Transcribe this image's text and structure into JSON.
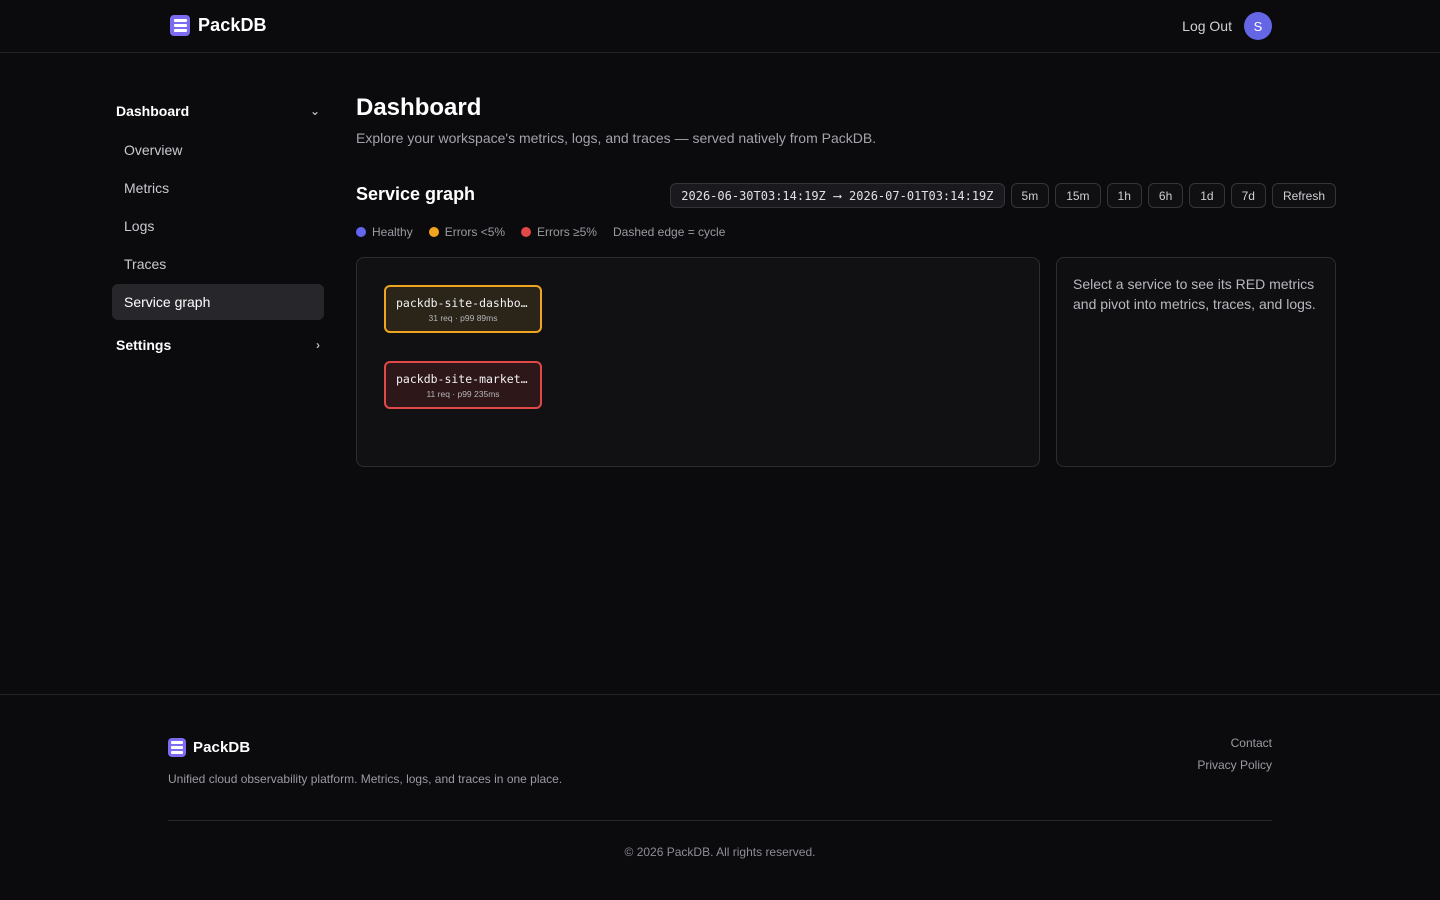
{
  "header": {
    "brand": "PackDB",
    "logout_label": "Log Out",
    "avatar_initial": "S"
  },
  "sidebar": {
    "sections": [
      {
        "label": "Dashboard",
        "expanded": true
      },
      {
        "label": "Settings",
        "expanded": false
      }
    ],
    "items": [
      {
        "label": "Overview"
      },
      {
        "label": "Metrics"
      },
      {
        "label": "Logs"
      },
      {
        "label": "Traces"
      },
      {
        "label": "Service graph",
        "active": true
      }
    ]
  },
  "main": {
    "title": "Dashboard",
    "subtitle": "Explore your workspace's metrics, logs, and traces — served natively from PackDB.",
    "section_title": "Service graph",
    "time_range": {
      "start": "2026-06-30T03:14:19Z",
      "arrow": "⟶",
      "end": "2026-07-01T03:14:19Z"
    },
    "range_buttons": [
      "5m",
      "15m",
      "1h",
      "6h",
      "1d",
      "7d"
    ],
    "refresh_label": "Refresh",
    "legend": {
      "healthy": "Healthy",
      "errors_low": "Errors <5%",
      "errors_high": "Errors ≥5%",
      "dashed": "Dashed edge = cycle"
    },
    "nodes": [
      {
        "name": "packdb-site-dashboard",
        "meta": "31 req · p99 89ms",
        "status": "warn"
      },
      {
        "name": "packdb-site-marketing",
        "meta": "11 req · p99 235ms",
        "status": "error"
      }
    ],
    "detail_text": "Select a service to see its RED metrics and pivot into metrics, traces, and logs."
  },
  "colors": {
    "accent": "#6566e6",
    "healthy": "#6366f1",
    "warn": "#f0a520",
    "error": "#e14848"
  },
  "footer": {
    "brand": "PackDB",
    "tagline": "Unified cloud observability platform. Metrics, logs, and traces in one place.",
    "links": [
      "Contact",
      "Privacy Policy"
    ],
    "copyright": "© 2026 PackDB. All rights reserved."
  }
}
